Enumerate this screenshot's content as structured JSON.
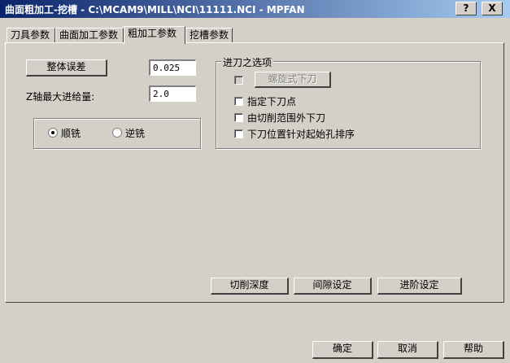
{
  "window": {
    "title": "曲面粗加工-挖槽 - C:\\MCAM9\\MILL\\NCI\\11111.NCI - MPFAN",
    "help_btn": "?",
    "close_btn": "X"
  },
  "tabs": [
    {
      "label": "刀具参数"
    },
    {
      "label": "曲面加工参数"
    },
    {
      "label": "粗加工参数"
    },
    {
      "label": "挖槽参数"
    }
  ],
  "left": {
    "tolerance_button": "整体误差",
    "tolerance_value": "0.025",
    "z_step_label": "Z轴最大进给量:",
    "z_step_value": "2.0",
    "climb_label": "顺铣",
    "conventional_label": "逆铣"
  },
  "entry": {
    "group_title": "进刀之选项",
    "helix_button": "螺旋式下刀",
    "specify_point": "指定下刀点",
    "outside_boundary": "由切削范围外下刀",
    "sort_holes": "下刀位置针对起始孔排序"
  },
  "panel_buttons": {
    "cut_depth": "切削深度",
    "gap_settings": "间隙设定",
    "advanced_settings": "进阶设定"
  },
  "footer": {
    "ok": "确定",
    "cancel": "取消",
    "help": "帮助"
  }
}
